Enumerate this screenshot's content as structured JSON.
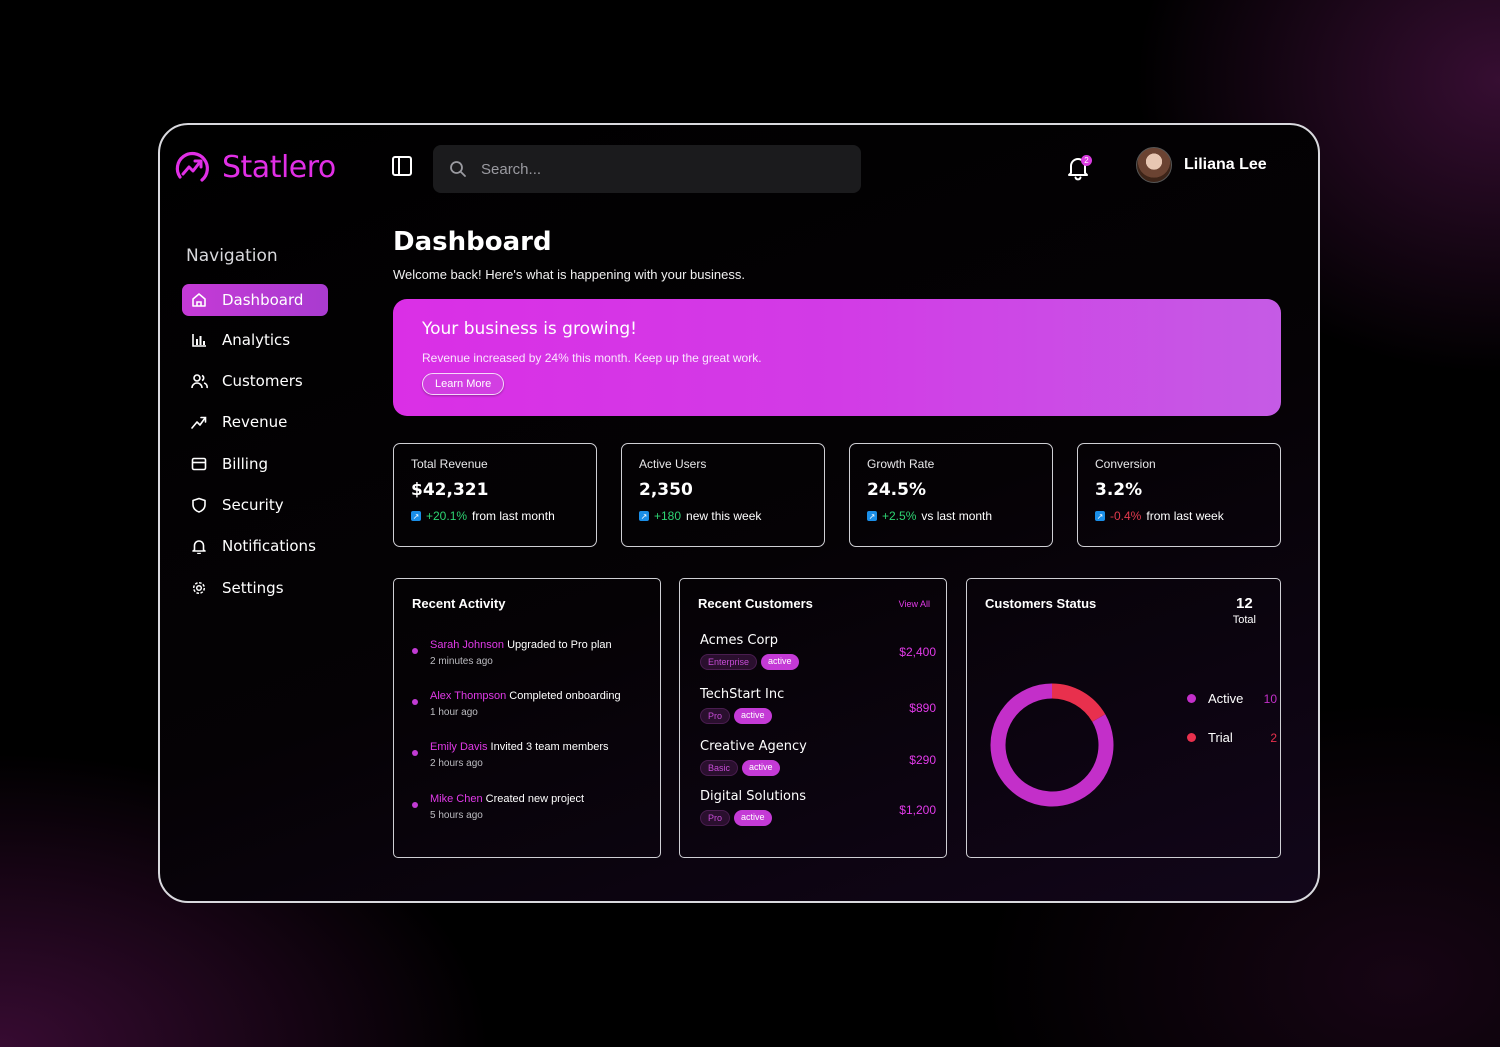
{
  "brand": {
    "name": "Statlero"
  },
  "search": {
    "placeholder": "Search..."
  },
  "notifications": {
    "badge_count": "2"
  },
  "user": {
    "name": "Liliana Lee"
  },
  "sidebar": {
    "title": "Navigation",
    "items": [
      {
        "label": "Dashboard",
        "icon": "home-icon",
        "active": true
      },
      {
        "label": "Analytics",
        "icon": "bar-chart-icon"
      },
      {
        "label": "Customers",
        "icon": "users-icon"
      },
      {
        "label": "Revenue",
        "icon": "trending-up-icon"
      },
      {
        "label": "Billing",
        "icon": "credit-card-icon"
      },
      {
        "label": "Security",
        "icon": "shield-icon"
      },
      {
        "label": "Notifications",
        "icon": "bell-icon"
      },
      {
        "label": "Settings",
        "icon": "gear-icon"
      }
    ]
  },
  "main": {
    "title": "Dashboard",
    "subtitle": "Welcome back! Here's what is happening with your business.",
    "banner": {
      "heading": "Your business is growing!",
      "text": "Revenue increased by 24% this month. Keep up the great work.",
      "button": "Learn More"
    },
    "stats": [
      {
        "label": "Total Revenue",
        "value": "$42,321",
        "change": "+20.1%",
        "change_text": "from last month",
        "trend": "positive"
      },
      {
        "label": "Active Users",
        "value": "2,350",
        "change": "+180",
        "change_text": "new this week",
        "trend": "positive"
      },
      {
        "label": "Growth Rate",
        "value": "24.5%",
        "change": "+2.5%",
        "change_text": "vs last month",
        "trend": "positive"
      },
      {
        "label": "Conversion",
        "value": "3.2%",
        "change": "-0.4%",
        "change_text": "from last week",
        "trend": "negative"
      }
    ],
    "recent_activity": {
      "title": "Recent Activity",
      "items": [
        {
          "user": "Sarah Johnson",
          "action": "Upgraded to Pro plan",
          "time": "2 minutes ago"
        },
        {
          "user": "Alex Thompson",
          "action": "Completed onboarding",
          "time": "1 hour ago"
        },
        {
          "user": "Emily Davis",
          "action": "Invited 3 team members",
          "time": "2 hours ago"
        },
        {
          "user": "Mike Chen",
          "action": "Created new project",
          "time": "5 hours ago"
        }
      ]
    },
    "recent_customers": {
      "title": "Recent Customers",
      "view_all": "View All",
      "items": [
        {
          "name": "Acmes Corp",
          "plan": "Enterprise",
          "status": "active",
          "amount": "$2,400"
        },
        {
          "name": "TechStart Inc",
          "plan": "Pro",
          "status": "active",
          "amount": "$890"
        },
        {
          "name": "Creative Agency",
          "plan": "Basic",
          "status": "active",
          "amount": "$290"
        },
        {
          "name": "Digital Solutions",
          "plan": "Pro",
          "status": "active",
          "amount": "$1,200"
        }
      ]
    },
    "customers_status": {
      "title": "Customers Status",
      "total": "12",
      "total_label": "Total",
      "legend": [
        {
          "label": "Active",
          "value": "10",
          "color": "#c32fc9"
        },
        {
          "label": "Trial",
          "value": "2",
          "color": "#e8304d"
        }
      ]
    }
  },
  "chart_data": {
    "type": "pie",
    "title": "Customers Status",
    "categories": [
      "Active",
      "Trial"
    ],
    "values": [
      10,
      2
    ],
    "colors": [
      "#c32fc9",
      "#e8304d"
    ],
    "donut": true
  }
}
